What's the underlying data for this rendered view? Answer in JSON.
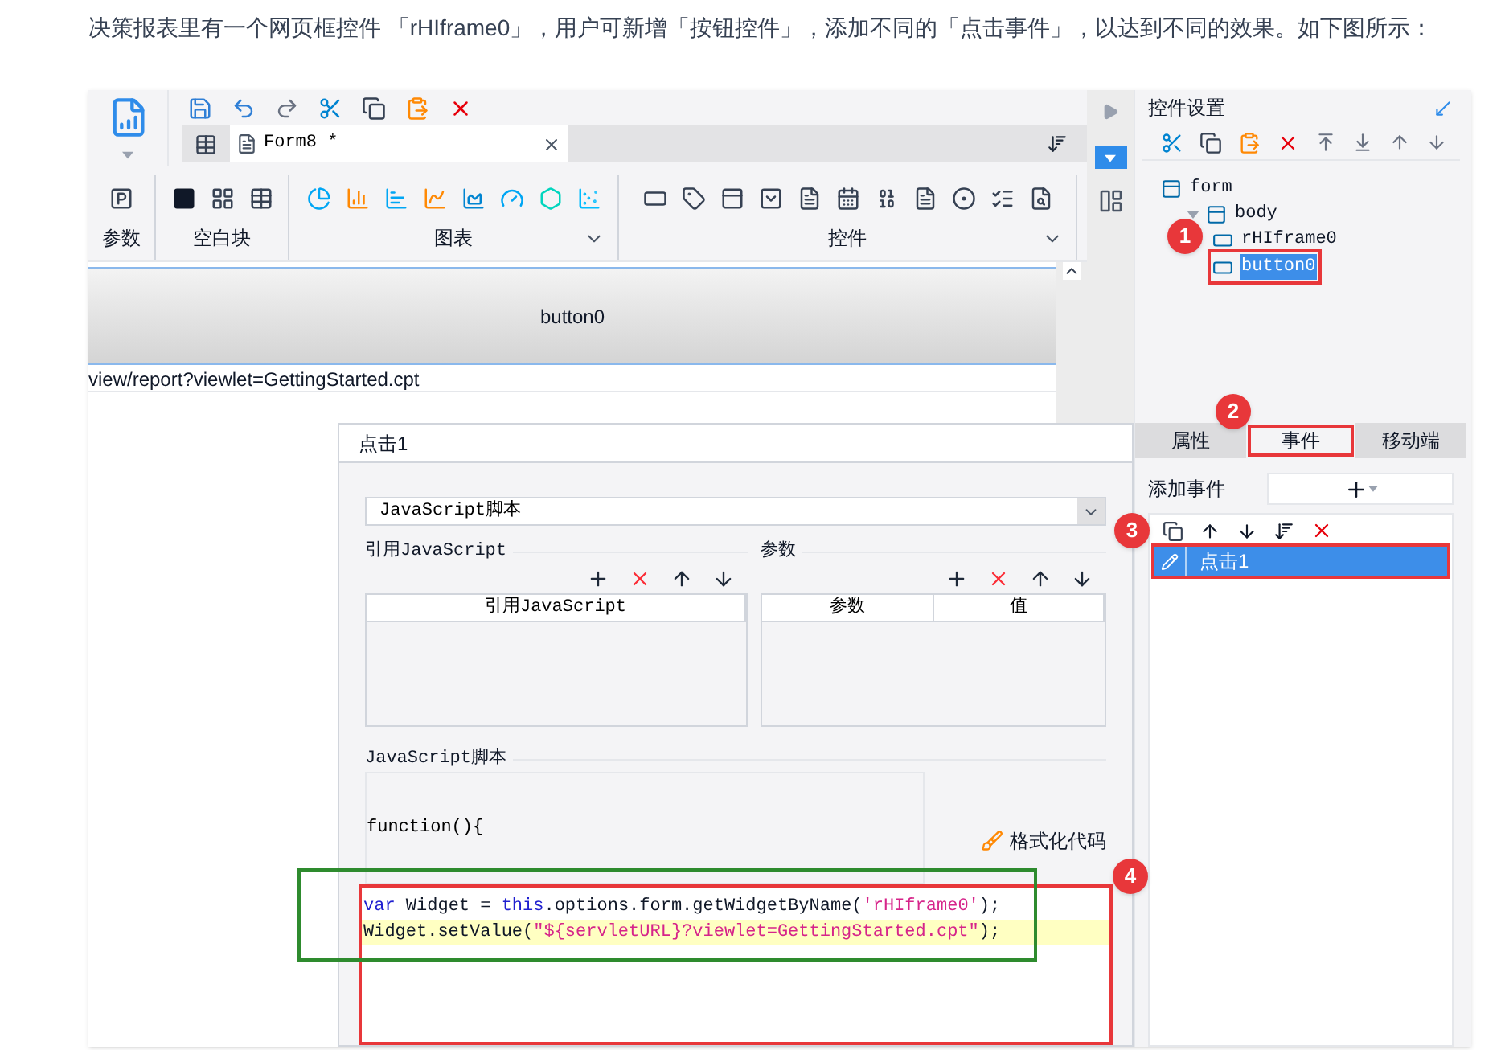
{
  "intro": "决策报表里有一个网页框控件 「rHIframe0」，用户可新增「按钮控件」，添加不同的「点击事件」，以达到不同的效果。如下图所示：",
  "designer": {
    "tab": {
      "label": "Form8 *"
    },
    "ribbon_groups": [
      {
        "label": "参数",
        "expandable": false
      },
      {
        "label": "空白块",
        "expandable": false
      },
      {
        "label": "图表",
        "expandable": true
      },
      {
        "label": "控件",
        "expandable": true
      }
    ],
    "canvas": {
      "button": "button0",
      "url": "view/report?viewlet=GettingStarted.cpt"
    }
  },
  "dialog": {
    "title": "点击1",
    "script_type": "JavaScript脚本",
    "import_section": {
      "label": "引用JavaScript",
      "columns": [
        "引用JavaScript"
      ]
    },
    "params_section": {
      "label": "参数",
      "columns": [
        "参数",
        "值"
      ]
    },
    "script_section": {
      "label": "JavaScript脚本",
      "header": "function(){",
      "format_button": "格式化代码",
      "code_lines": [
        {
          "highlighted": false,
          "tokens": [
            {
              "t": "var",
              "kind": "keyword"
            },
            {
              "t": " Widget = ",
              "kind": "plain"
            },
            {
              "t": "this",
              "kind": "keyword"
            },
            {
              "t": ".options.form.getWidgetByName(",
              "kind": "plain"
            },
            {
              "t": "'rHIframe0'",
              "kind": "string"
            },
            {
              "t": ");",
              "kind": "plain"
            }
          ]
        },
        {
          "highlighted": true,
          "tokens": [
            {
              "t": "Widget.setValue(",
              "kind": "plain"
            },
            {
              "t": "\"${servletURL}?viewlet=GettingStarted.cpt\"",
              "kind": "string"
            },
            {
              "t": ");",
              "kind": "plain"
            }
          ]
        }
      ]
    }
  },
  "settings_panel": {
    "title": "控件设置",
    "tree": [
      {
        "label": "form",
        "selected": false,
        "children": [
          {
            "label": "body",
            "selected": false,
            "expanded": true,
            "children": [
              {
                "label": "rHIframe0",
                "selected": false
              },
              {
                "label": "button0",
                "selected": true
              }
            ]
          }
        ]
      }
    ],
    "tabs": [
      {
        "label": "属性",
        "selected": false
      },
      {
        "label": "事件",
        "selected": true
      },
      {
        "label": "移动端",
        "selected": false
      }
    ],
    "add_event_label": "添加事件",
    "events": [
      {
        "label": "点击1",
        "selected": true
      }
    ]
  },
  "annotations": [
    "1",
    "2",
    "3",
    "4"
  ]
}
